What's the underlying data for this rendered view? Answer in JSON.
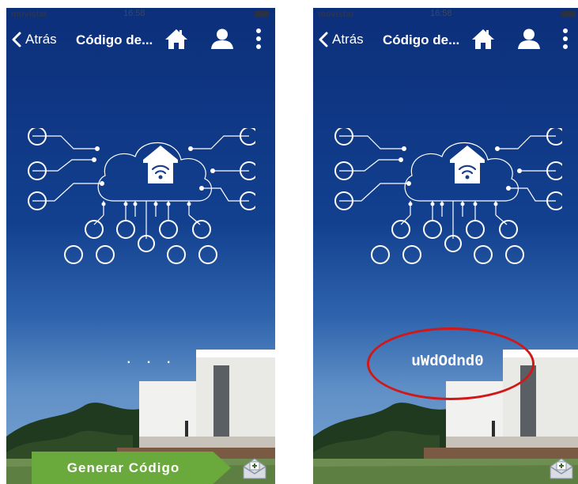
{
  "screens": [
    {
      "status": {
        "carrier": "movistar",
        "time": "16:58"
      },
      "nav": {
        "back_label": "Atrás",
        "title": "Código de..."
      },
      "code_text": ". . .",
      "generate_label": "Generar Código"
    },
    {
      "status": {
        "carrier": "movistar",
        "time": "16:58"
      },
      "nav": {
        "back_label": "Atrás",
        "title": "Código de..."
      },
      "code_text": "uWdOdnd0"
    }
  ],
  "colors": {
    "button_green": "#6aa93b",
    "highlight_red": "#d01818",
    "sky_top": "#0c2f7a"
  },
  "icons": [
    "chevron-left-icon",
    "home-icon",
    "user-icon",
    "more-vertical-icon",
    "cloud-house-wifi-icon",
    "mail-add-icon"
  ]
}
